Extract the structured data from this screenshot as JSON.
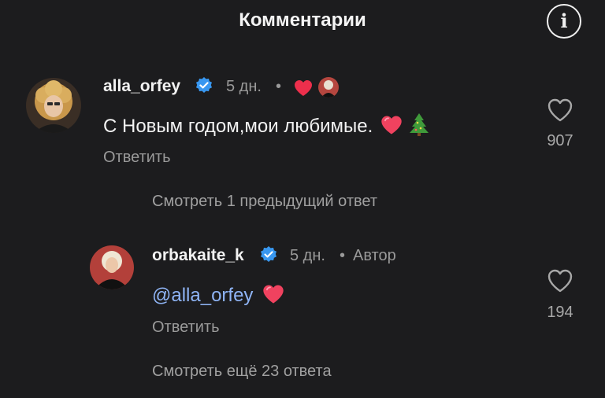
{
  "header": {
    "title": "Комментарии",
    "info_icon": "info-icon"
  },
  "comments": [
    {
      "username": "alla_orfey",
      "verified": true,
      "time": "5 дн.",
      "separator": "•",
      "liked_by_author": true,
      "text": "С Новым годом,мои любимые.",
      "emoji": [
        "heart-emoji",
        "christmas-tree-emoji"
      ],
      "reply_label": "Ответить",
      "likes": "907",
      "view_replies": "Смотреть 1 предыдущий ответ"
    },
    {
      "username": "orbakaite_k",
      "verified": true,
      "time": "5 дн.",
      "separator": "•",
      "author_badge": "Автор",
      "mention": "@alla_orfey",
      "emoji": [
        "heart-emoji"
      ],
      "reply_label": "Ответить",
      "likes": "194",
      "view_replies": "Смотреть ещё 23 ответа"
    }
  ],
  "colors": {
    "background": "#1c1c1e",
    "verified_badge": "#3897f0",
    "mention": "#8fb4f5",
    "heart": "#ed2f4c"
  }
}
